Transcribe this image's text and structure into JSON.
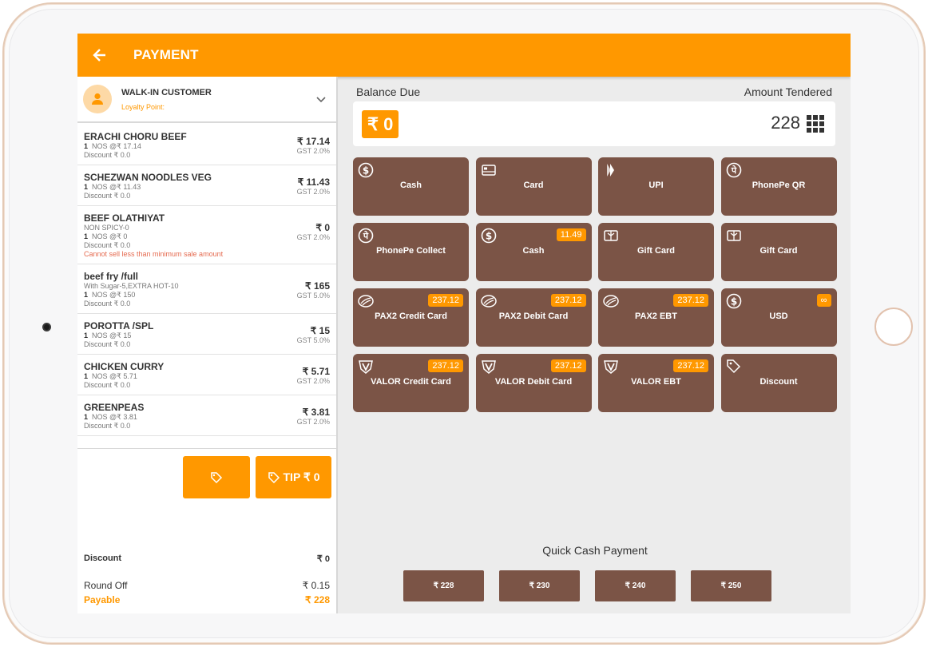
{
  "header": {
    "back_icon": "arrow-left-icon",
    "title": "PAYMENT"
  },
  "customer": {
    "name": "WALK-IN CUSTOMER",
    "loyalty_label": "Loyalty Point:"
  },
  "items": [
    {
      "name": "ERACHI CHORU BEEF",
      "extra": "",
      "qty": "1",
      "qty_detail": "NOS @₹ 17.14",
      "discount": "Discount ₹ 0.0",
      "warning": "",
      "price": "₹ 17.14",
      "gst": "GST 2.0%"
    },
    {
      "name": "SCHEZWAN NOODLES VEG",
      "extra": "",
      "qty": "1",
      "qty_detail": "NOS @₹ 11.43",
      "discount": "Discount ₹ 0.0",
      "warning": "",
      "price": "₹ 11.43",
      "gst": "GST 2.0%"
    },
    {
      "name": "BEEF OLATHIYAT",
      "extra": "NON SPICY-0",
      "qty": "1",
      "qty_detail": "NOS @₹ 0",
      "discount": "Discount ₹ 0.0",
      "warning": "Cannot sell less than minimum sale amount",
      "price": "₹ 0",
      "gst": "GST 2.0%"
    },
    {
      "name": "beef fry /full",
      "extra": "With Sugar-5,EXTRA HOT-10",
      "qty": "1",
      "qty_detail": "NOS @₹ 150",
      "discount": "Discount ₹ 0.0",
      "warning": "",
      "price": "₹ 165",
      "gst": "GST 5.0%"
    },
    {
      "name": "POROTTA /SPL",
      "extra": "",
      "qty": "1",
      "qty_detail": "NOS @₹ 15",
      "discount": "Discount ₹ 0.0",
      "warning": "",
      "price": "₹ 15",
      "gst": "GST 5.0%"
    },
    {
      "name": "CHICKEN CURRY",
      "extra": "",
      "qty": "1",
      "qty_detail": "NOS @₹ 5.71",
      "discount": "Discount ₹ 0.0",
      "warning": "",
      "price": "₹ 5.71",
      "gst": "GST 2.0%"
    },
    {
      "name": "GREENPEAS",
      "extra": "",
      "qty": "1",
      "qty_detail": "NOS @₹ 3.81",
      "discount": "Discount ₹ 0.0",
      "warning": "",
      "price": "₹ 3.81",
      "gst": "GST 2.0%"
    }
  ],
  "actions": {
    "tag_icon": "tag-icon",
    "tip_label": "TIP ₹ 0"
  },
  "summary": {
    "discount_label": "Discount",
    "discount_value": "₹ 0",
    "roundoff_label": "Round Off",
    "roundoff_value": "₹ 0.15",
    "payable_label": "Payable",
    "payable_value": "₹ 228"
  },
  "payment": {
    "balance_label": "Balance Due",
    "balance_value": "₹ 0",
    "tendered_label": "Amount Tendered",
    "tendered_value": "228",
    "methods": [
      {
        "label": "Cash",
        "icon": "dollar-circle-icon",
        "badge": ""
      },
      {
        "label": "Card",
        "icon": "card-icon",
        "badge": ""
      },
      {
        "label": "UPI",
        "icon": "upi-icon",
        "badge": ""
      },
      {
        "label": "PhonePe QR",
        "icon": "phonepe-icon",
        "badge": ""
      },
      {
        "label": "PhonePe Collect",
        "icon": "phonepe-icon",
        "badge": ""
      },
      {
        "label": "Cash",
        "icon": "dollar-circle-icon",
        "badge": "11.49"
      },
      {
        "label": "Gift Card",
        "icon": "gift-card-icon",
        "badge": ""
      },
      {
        "label": "Gift Card",
        "icon": "gift-card-icon",
        "badge": ""
      },
      {
        "label": "PAX2 Credit Card",
        "icon": "pax-icon",
        "badge": "237.12"
      },
      {
        "label": "PAX2 Debit Card",
        "icon": "pax-icon",
        "badge": "237.12"
      },
      {
        "label": "PAX2 EBT",
        "icon": "pax-icon",
        "badge": "237.12"
      },
      {
        "label": "USD",
        "icon": "dollar-circle-icon",
        "badge": "∞"
      },
      {
        "label": "VALOR Credit Card",
        "icon": "valor-icon",
        "badge": "237.12"
      },
      {
        "label": "VALOR Debit Card",
        "icon": "valor-icon",
        "badge": "237.12"
      },
      {
        "label": "VALOR EBT",
        "icon": "valor-icon",
        "badge": "237.12"
      },
      {
        "label": "Discount",
        "icon": "tag-icon",
        "badge": ""
      }
    ]
  },
  "quick_cash": {
    "label": "Quick Cash Payment",
    "amounts": [
      "₹ 228",
      "₹ 230",
      "₹ 240",
      "₹ 250"
    ]
  },
  "colors": {
    "accent": "#ff9800",
    "tile": "#7b5446",
    "warning": "#e56a4f"
  }
}
